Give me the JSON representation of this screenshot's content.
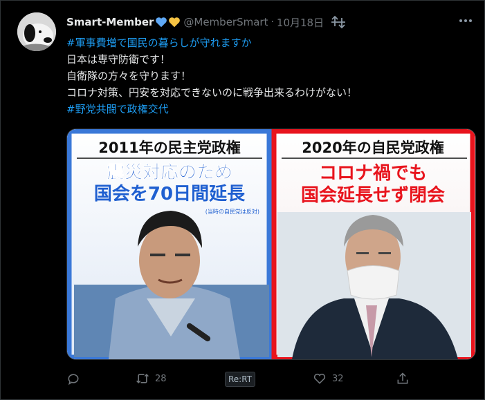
{
  "tweet": {
    "display_name": "Smart-Member",
    "handle": "@MemberSmart",
    "separator": "·",
    "date": "10月18日",
    "lines": [
      {
        "text": "#軍事費増で国民の暮らしが守れますか",
        "hashtag": true
      },
      {
        "text": "日本は専守防衛です！",
        "hashtag": false
      },
      {
        "text": "自衛隊の方々を守ります！",
        "hashtag": false
      },
      {
        "text": "コロナ対策、円安を対応できないのに戦争出来るわけがない！",
        "hashtag": false
      },
      {
        "text": "#野党共闘で政権交代",
        "hashtag": true
      }
    ]
  },
  "media": {
    "left_panel": {
      "title": "2011年の民主党政権",
      "line1": "震災対応のため",
      "line2": "国会を70日間延長",
      "note": "(当時の自民党は反対)"
    },
    "right_panel": {
      "title": "2020年の自民党政権",
      "line1": "コロナ禍でも",
      "line2": "国会延長せず閉会"
    }
  },
  "actions": {
    "reply_count": "",
    "retweet_count": "28",
    "rert_label": "Re:RT",
    "like_count": "32"
  },
  "colors": {
    "background": "#000000",
    "text": "#e7e9ea",
    "muted": "#71767b",
    "hashtag": "#1d9bf0",
    "heart_blue": "#5fa8f5",
    "heart_yellow": "#f6c343",
    "panel_blue": "#3a78d8",
    "panel_red": "#e8141d"
  },
  "icons": [
    "avatar-snoopy",
    "blue-heart-icon",
    "yellow-heart-icon",
    "sort-icon",
    "more-icon",
    "reply-icon",
    "retweet-icon",
    "like-icon",
    "share-icon"
  ]
}
